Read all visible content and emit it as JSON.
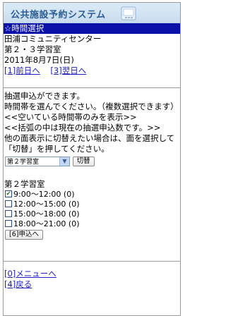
{
  "header": {
    "banner_title": "公共施設予約システム",
    "section_bar": "☆時間選択"
  },
  "facility": {
    "center": "田浦コミュニティセンター",
    "room": "第２・３学習室",
    "date": "2011年8月7日(日)"
  },
  "nav": {
    "prev_day": "[1]前日へ",
    "next_day": "[3]翌日へ"
  },
  "messages": [
    "抽選申込ができます。",
    "時間帯を選んでください。（複数選択できます）",
    "<<空いている時間帯のみを表示>>",
    "<<括弧の中は現在の抽選申込数です。>>",
    "他の面表示に切替えたい場合は、面を選択して「切替」を押してください。"
  ],
  "room_select": {
    "selected": "第２学習室",
    "switch_label": "切替"
  },
  "room_heading": "第２学習室",
  "slots": [
    {
      "label": "9:00〜12:00",
      "count": "(0)",
      "checked": true
    },
    {
      "label": "12:00〜15:00",
      "count": "(0)",
      "checked": false
    },
    {
      "label": "15:00〜18:00",
      "count": "(0)",
      "checked": false
    },
    {
      "label": "18:00〜21:00",
      "count": "(0)",
      "checked": false
    }
  ],
  "apply_button": "[6]申込へ",
  "footer": {
    "menu_link": "[0]メニューへ",
    "back_link": "[4]戻る"
  }
}
